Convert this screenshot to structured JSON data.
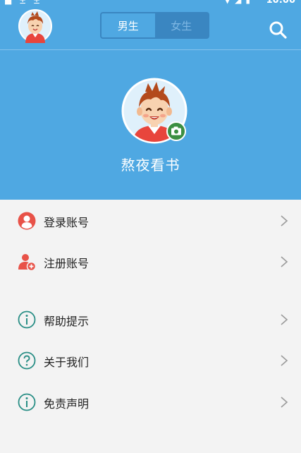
{
  "status_bar": {
    "time": "10:00",
    "left_icons": "■ ± ±"
  },
  "app_bar": {
    "tabs": [
      {
        "label": "男生",
        "selected": true
      },
      {
        "label": "女生",
        "selected": false
      }
    ],
    "search_icon": "search-icon",
    "avatar_icon": "cartoon-boy-avatar"
  },
  "profile": {
    "username": "熬夜看书",
    "camera_icon": "camera-icon"
  },
  "menu": {
    "items": [
      {
        "label": "登录账号",
        "icon": "user-login-icon"
      },
      {
        "label": "注册账号",
        "icon": "user-add-icon"
      },
      {
        "label": "帮助提示",
        "icon": "info-circle-icon"
      },
      {
        "label": "关于我们",
        "icon": "question-circle-icon"
      },
      {
        "label": "免责声明",
        "icon": "info-circle-icon"
      }
    ]
  },
  "colors": {
    "primary": "#4fa8e2",
    "primary_dark": "#3a86c1",
    "red": "#e85248",
    "teal": "#2a8f86",
    "green": "#3b8f42"
  }
}
